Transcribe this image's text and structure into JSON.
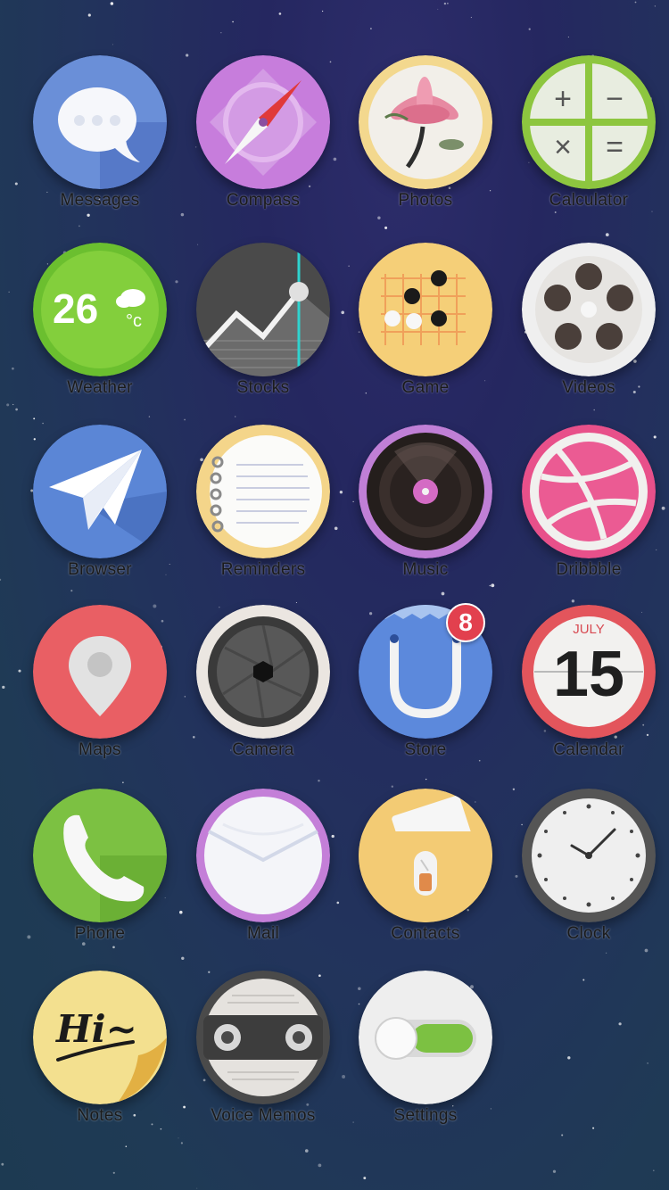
{
  "home": {
    "apps": {
      "messages": {
        "label": "Messages"
      },
      "compass": {
        "label": "Compass"
      },
      "photos": {
        "label": "Photos"
      },
      "calculator": {
        "label": "Calculator",
        "keys": [
          "+",
          "−",
          "×",
          "="
        ]
      },
      "weather": {
        "label": "Weather",
        "temperature": "26",
        "unit": "°c"
      },
      "stocks": {
        "label": "Stocks"
      },
      "game": {
        "label": "Game"
      },
      "videos": {
        "label": "Videos"
      },
      "browser": {
        "label": "Browser"
      },
      "reminders": {
        "label": "Reminders"
      },
      "music": {
        "label": "Music"
      },
      "dribbble": {
        "label": "Dribbble"
      },
      "maps": {
        "label": "Maps"
      },
      "camera": {
        "label": "Camera"
      },
      "store": {
        "label": "Store",
        "badge": "8"
      },
      "calendar": {
        "label": "Calendar",
        "month": "JULY",
        "day": "15"
      },
      "phone": {
        "label": "Phone"
      },
      "mail": {
        "label": "Mail"
      },
      "contacts": {
        "label": "Contacts"
      },
      "clock": {
        "label": "Clock"
      },
      "notes": {
        "label": "Notes",
        "text": "Hi~"
      },
      "voice_memos": {
        "label": "Voice Memos"
      },
      "settings": {
        "label": "Settings"
      }
    }
  },
  "colors": {
    "messages": "#6a8fd8",
    "compass": "#c77ddc",
    "photos": "#f3d88e",
    "calculator": "#8dc63f",
    "weather": "#6bbf2f",
    "stocks": "#4a4a4a",
    "game": "#f5cf78",
    "videos": "#efefef",
    "browser": "#5b86d6",
    "reminders": "#f4d58a",
    "music": "#c07fd6",
    "dribbble": "#e8508a",
    "maps": "#e95f64",
    "camera": "#ebe6e1",
    "store": "#5c89dc",
    "calendar": "#e3555c",
    "phone": "#7cc142",
    "mail": "#c47fd8",
    "contacts": "#f3cb74",
    "clock": "#555555",
    "notes": "#f3e08f",
    "voice_memos": "#4a4a4a",
    "settings": "#eeeeee",
    "badge": "#e2404e"
  }
}
